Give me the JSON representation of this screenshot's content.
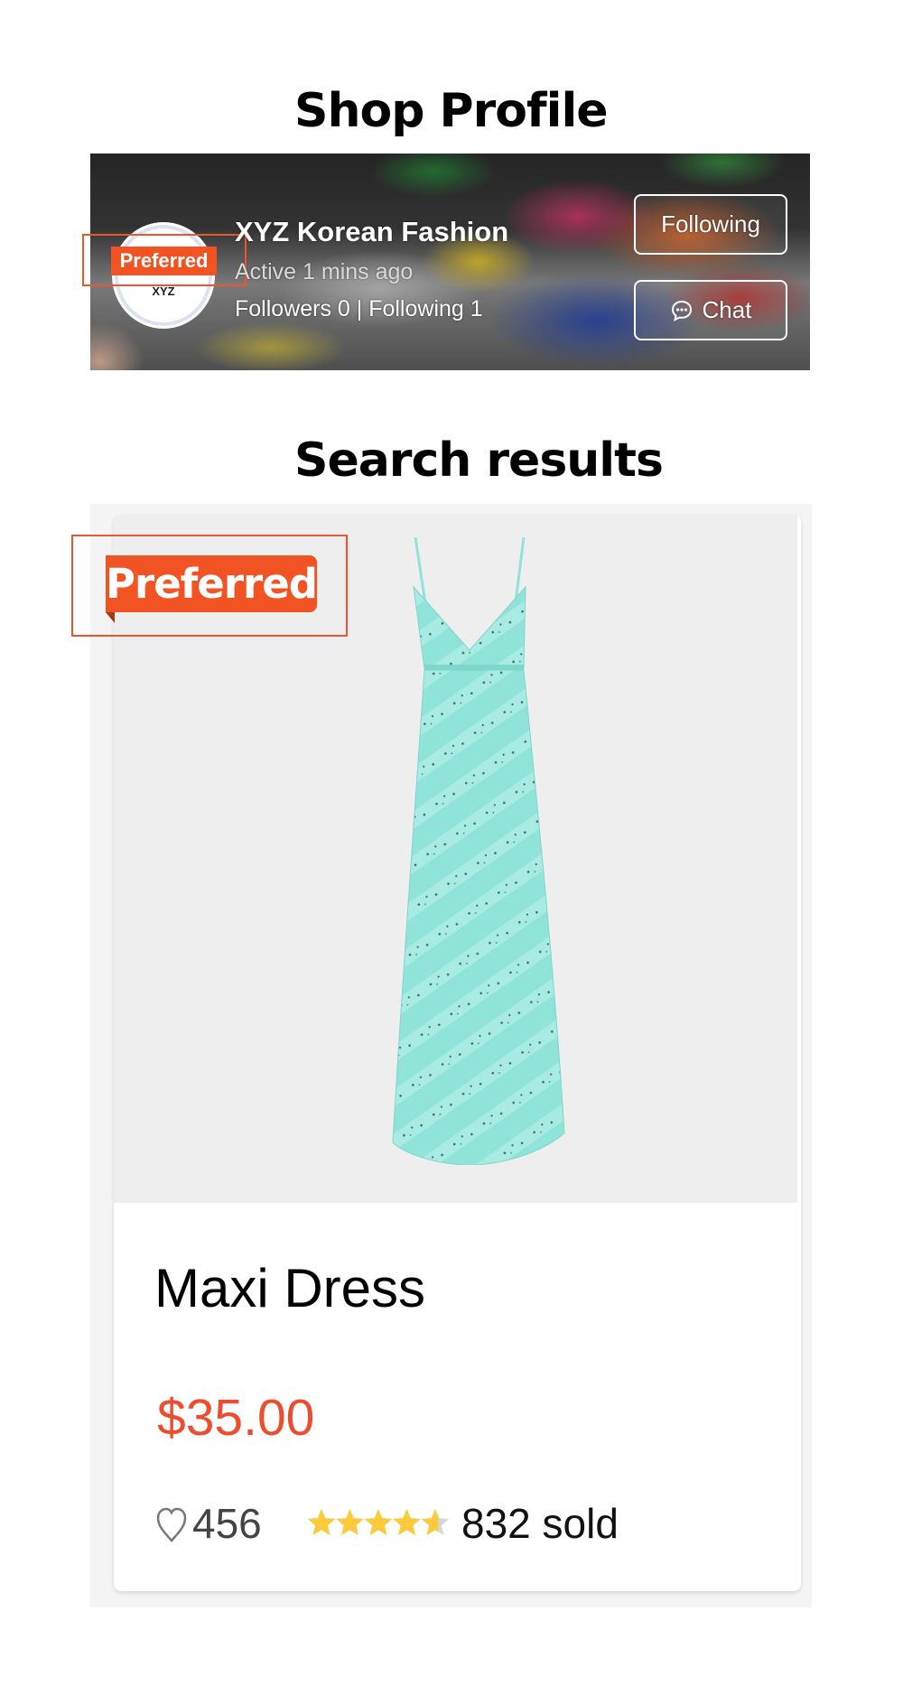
{
  "sections": {
    "shop_profile_title": "Shop Profile",
    "search_results_title": "Search results"
  },
  "shop": {
    "name": "XYZ Korean Fashion",
    "status": "Active 1 mins ago",
    "followers_line": "Followers 0 | Following 1",
    "avatar_text": "XYZ",
    "badge": "Preferred",
    "buttons": {
      "following": "Following",
      "chat": "Chat"
    },
    "icons": {
      "chat": "chat-bubble-icon"
    }
  },
  "product": {
    "badge": "Preferred",
    "name": "Maxi Dress",
    "price": "$35.00",
    "likes": "456",
    "rating": 4.6,
    "rating_max": 5,
    "sold": "832 sold",
    "icons": {
      "like": "heart-outline-icon",
      "rating": "star-icon"
    }
  },
  "colors": {
    "accent": "#ee4d2d",
    "badge": "#f25322",
    "highlight_outline": "#e9572f",
    "star_filled": "#fdca3a",
    "star_empty": "#d6d6d6",
    "dress": "#8fe3d8"
  }
}
